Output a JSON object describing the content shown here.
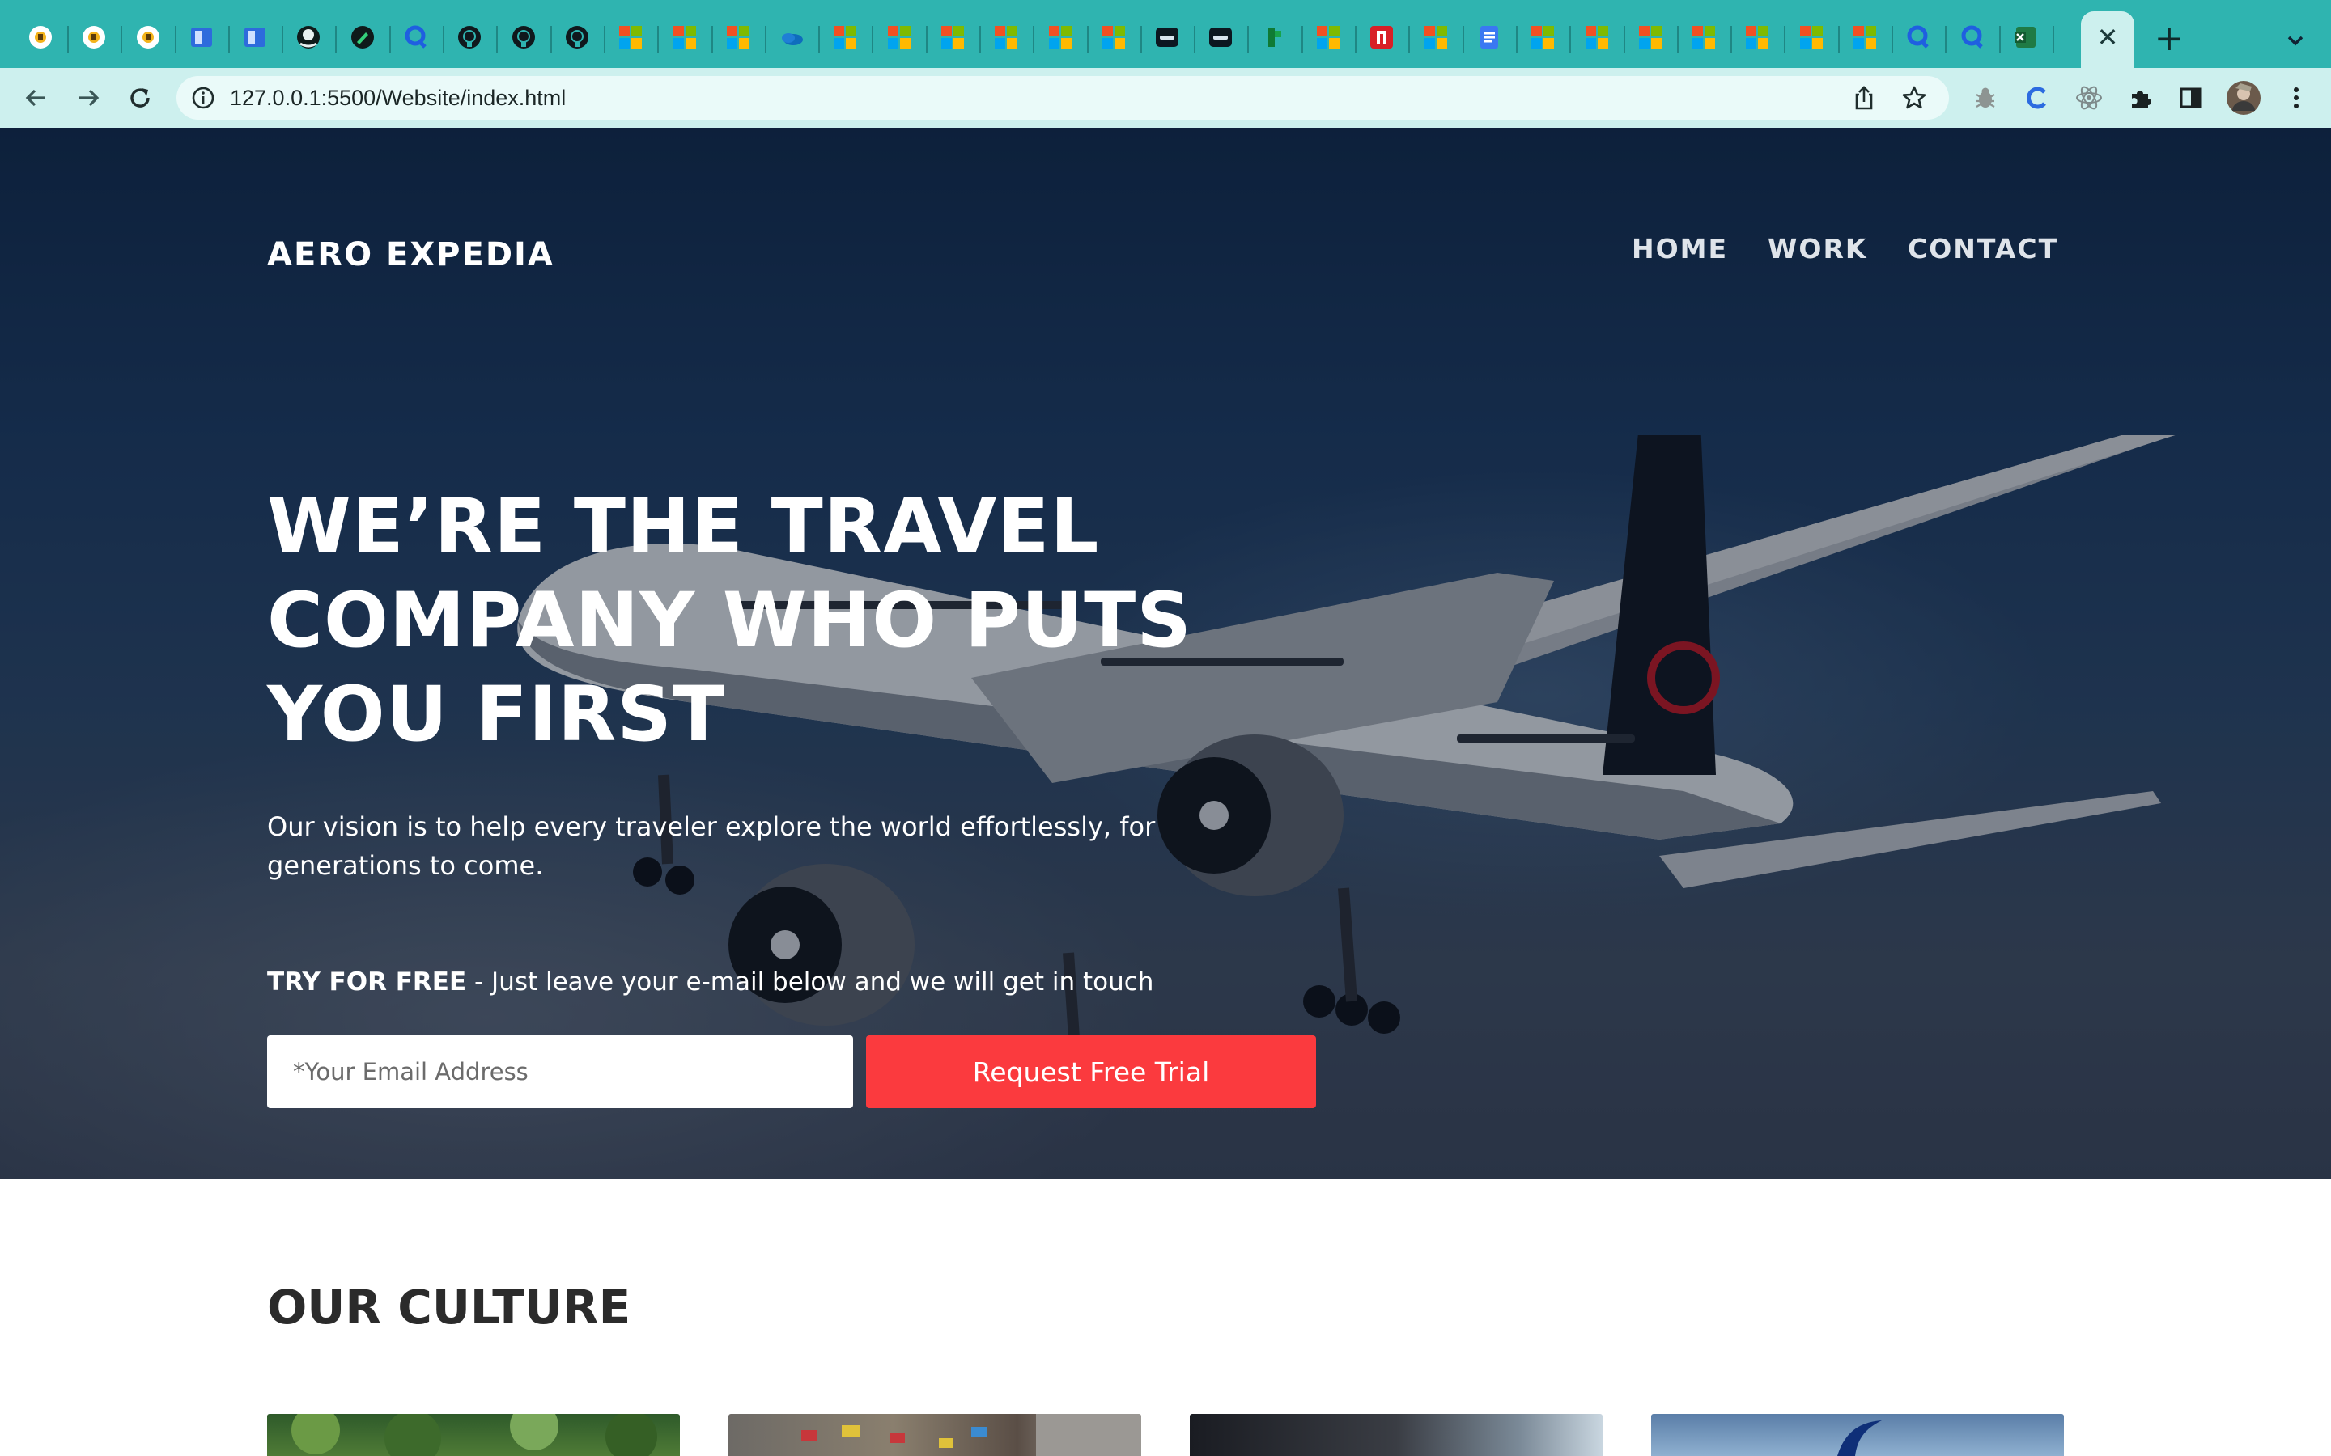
{
  "browser": {
    "tabs": [
      {
        "icon": "app-icon"
      },
      {
        "icon": "app-icon"
      },
      {
        "icon": "app-icon"
      },
      {
        "icon": "panel-icon"
      },
      {
        "icon": "panel-icon"
      },
      {
        "icon": "octopus-icon"
      },
      {
        "icon": "edit-icon"
      },
      {
        "icon": "qwiklabs-icon"
      },
      {
        "icon": "github-icon"
      },
      {
        "icon": "github-icon"
      },
      {
        "icon": "github-icon"
      },
      {
        "icon": "microsoft-icon"
      },
      {
        "icon": "microsoft-icon"
      },
      {
        "icon": "microsoft-icon"
      },
      {
        "icon": "onedrive-icon"
      },
      {
        "icon": "microsoft-icon"
      },
      {
        "icon": "microsoft-icon"
      },
      {
        "icon": "microsoft-icon"
      },
      {
        "icon": "microsoft-icon"
      },
      {
        "icon": "microsoft-icon"
      },
      {
        "icon": "microsoft-icon"
      },
      {
        "icon": "terminal-icon"
      },
      {
        "icon": "terminal-icon"
      },
      {
        "icon": "green-app-icon"
      },
      {
        "icon": "microsoft-icon"
      },
      {
        "icon": "netflix-icon"
      },
      {
        "icon": "microsoft-icon"
      },
      {
        "icon": "docs-icon"
      },
      {
        "icon": "microsoft-icon"
      },
      {
        "icon": "microsoft-icon"
      },
      {
        "icon": "microsoft-icon"
      },
      {
        "icon": "microsoft-icon"
      },
      {
        "icon": "microsoft-icon"
      },
      {
        "icon": "microsoft-icon"
      },
      {
        "icon": "microsoft-icon"
      },
      {
        "icon": "qwiklabs-icon"
      },
      {
        "icon": "qwiklabs-icon"
      },
      {
        "icon": "excel-icon"
      }
    ],
    "active_tab_close": "✕",
    "new_tab": "+",
    "url": "127.0.0.1:5500/Website/index.html"
  },
  "site": {
    "brand": "AERO EXPEDIA",
    "nav": [
      "HOME",
      "WORK",
      "CONTACT"
    ],
    "headline": [
      "WE’RE THE TRAVEL",
      "COMPANY WHO PUTS",
      "YOU FIRST"
    ],
    "vision": "Our vision is to help every traveler explore the world effortlessly, for generations to come.",
    "try_bold": "TRY FOR FREE",
    "try_rest": " - Just leave your e-mail below and we will get in touch",
    "email_placeholder": "*Your Email Address",
    "cta_label": "Request Free Trial",
    "culture_title": "OUR CULTURE"
  },
  "colors": {
    "tabstrip": "#2fb4b0",
    "toolbar": "#cdf0ee",
    "cta": "#fb3a3e"
  }
}
